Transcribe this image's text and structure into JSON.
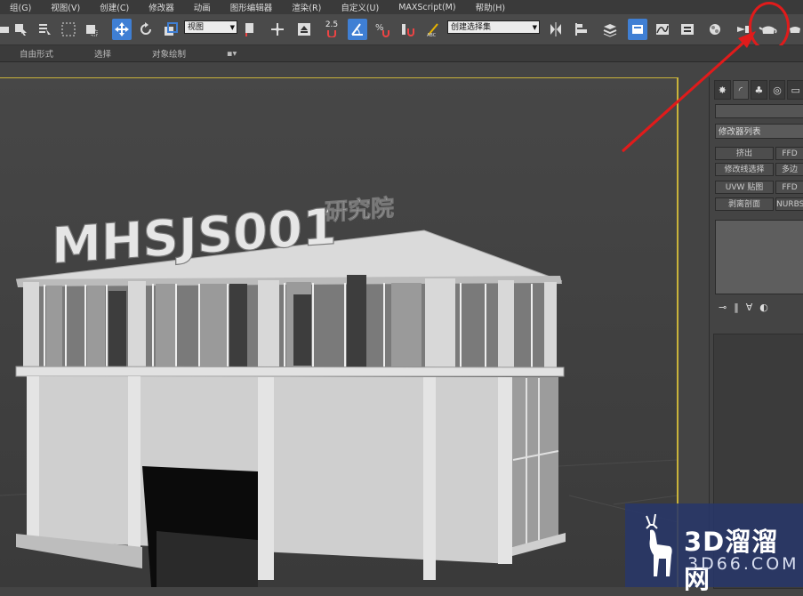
{
  "menubar": {
    "items": [
      "组(G)",
      "视图(V)",
      "创建(C)",
      "修改器",
      "动画",
      "图形编辑器",
      "渲染(R)",
      "自定义(U)",
      "MAXScript(M)",
      "帮助(H)"
    ]
  },
  "toolbar": {
    "view_dropdown": "视图",
    "selection_set_dropdown": "创建选择集",
    "snap_label": "2.5",
    "icons": [
      "undo-icon",
      "select-object-icon",
      "select-by-name-icon",
      "rect-select-icon",
      "window-crossing-icon",
      "move-icon",
      "rotate-icon",
      "scale-icon",
      "pivot-icon",
      "manipulate-icon",
      "keyboard-shortcut-icon",
      "snap-toggle-icon",
      "angle-snap-icon",
      "percent-snap-icon",
      "spinner-snap-icon",
      "edit-named-selection-icon",
      "mirror-icon",
      "align-icon",
      "layer-manager-icon",
      "graphite-icon",
      "curve-editor-icon",
      "schematic-view-icon",
      "material-editor-icon",
      "render-setup-icon",
      "rendered-frame-icon",
      "render-teapot-icon"
    ]
  },
  "ribbon": {
    "tabs": [
      "自由形式",
      "选择",
      "对象绘制"
    ]
  },
  "scene": {
    "sign_text": "MHSJS001",
    "sign_suffix": "研究院"
  },
  "command_panel": {
    "modifier_list": "修改器列表",
    "buttons": [
      "挤出",
      "FFD",
      "修改线选择",
      "多边",
      "UVW 贴图",
      "FFD",
      "剥离剖面",
      "NURBS"
    ]
  },
  "watermark": {
    "brand": "3D溜溜网",
    "url": "3D66.COM"
  },
  "colors": {
    "accent_active": "#3f7fd4",
    "viewport_border": "#c9b33a",
    "annotation_red": "#e01b1b",
    "watermark_bg": "#283769"
  }
}
